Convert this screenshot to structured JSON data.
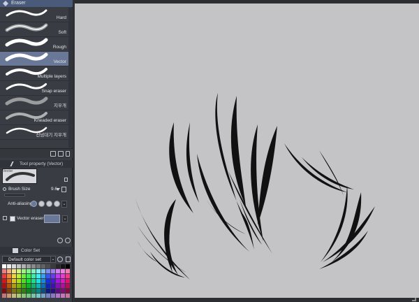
{
  "subtool_panel": {
    "title": "Eraser",
    "brushes": [
      {
        "label": "Hard",
        "selected": false
      },
      {
        "label": "Soft",
        "selected": false
      },
      {
        "label": "Rough",
        "selected": false
      },
      {
        "label": "Vector",
        "selected": true
      },
      {
        "label": "Multiple layers",
        "selected": false
      },
      {
        "label": "Snap eraser",
        "selected": false
      },
      {
        "label": "지우개",
        "selected": false
      },
      {
        "label": "Kneaded eraser",
        "selected": false
      },
      {
        "label": "선넘대기 지우개",
        "selected": false
      }
    ]
  },
  "tool_property": {
    "title": "Tool property (Vector)",
    "preview_label": "Vector",
    "brush_size_label": "Brush Size",
    "brush_size_value": "9.6",
    "anti_aliasing_label": "Anti-aliasing",
    "vector_eraser_label": "Vector eraser",
    "vector_eraser_checked": true
  },
  "color_set": {
    "title": "Color Set",
    "selected_set": "Default color set"
  },
  "colors": {
    "accent": "#6a7898",
    "canvas": "#c4c3c6",
    "panel": "#393c42",
    "ink": "#111111"
  }
}
